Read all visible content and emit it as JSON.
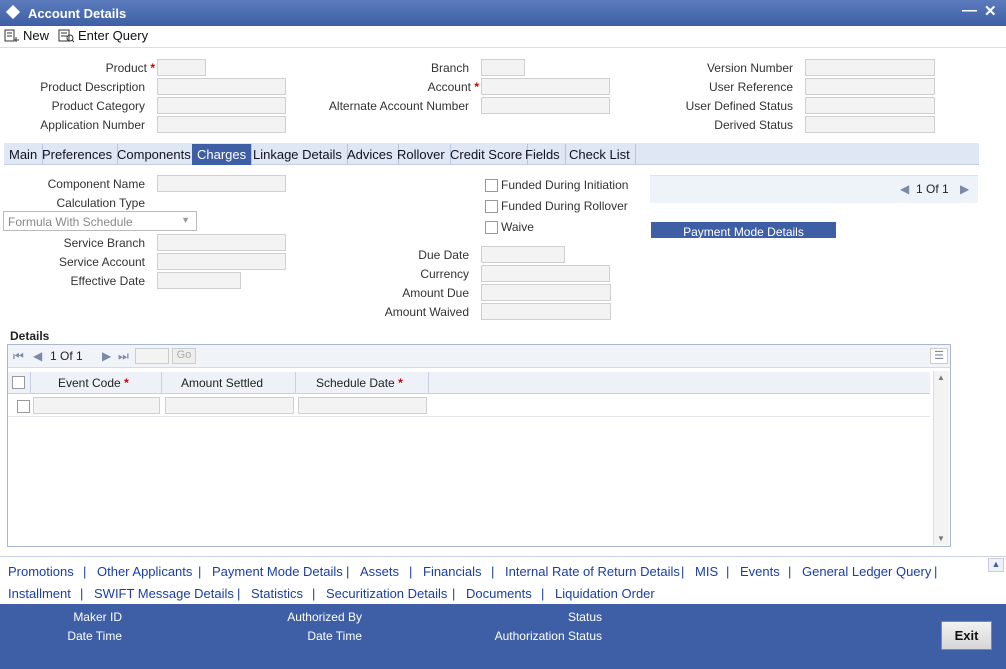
{
  "window": {
    "title": "Account Details",
    "minimize_icon": "minimize-icon",
    "close_icon": "close-icon"
  },
  "toolbar": {
    "new_label": "New",
    "enter_query_label": "Enter Query"
  },
  "header": {
    "product_label": "Product",
    "product_description_label": "Product Description",
    "product_category_label": "Product Category",
    "application_number_label": "Application Number",
    "branch_label": "Branch",
    "account_label": "Account",
    "alternate_account_number_label": "Alternate Account Number",
    "version_number_label": "Version Number",
    "user_reference_label": "User Reference",
    "user_defined_status_label": "User Defined Status",
    "derived_status_label": "Derived Status",
    "required_mark": "*"
  },
  "tabs": [
    "Main",
    "Preferences",
    "Components",
    "Charges",
    "Linkage Details",
    "Advices",
    "Rollover",
    "Credit Score",
    "Fields",
    "Check List"
  ],
  "charges": {
    "component_name_label": "Component Name",
    "calculation_type_label": "Calculation Type",
    "calculation_type_value": "Formula With Schedule",
    "service_branch_label": "Service Branch",
    "service_account_label": "Service Account",
    "effective_date_label": "Effective Date",
    "funded_during_initiation_label": "Funded During Initiation",
    "funded_during_rollover_label": "Funded During Rollover",
    "waive_label": "Waive",
    "due_date_label": "Due Date",
    "currency_label": "Currency",
    "amount_due_label": "Amount Due",
    "amount_waived_label": "Amount Waived",
    "pager_text": "1 Of 1",
    "payment_mode_button": "Payment Mode Details"
  },
  "details": {
    "section_title": "Details",
    "pager_text": "1 Of 1",
    "go_label": "Go",
    "columns": [
      "Event Code",
      "Amount Settled",
      "Schedule Date"
    ]
  },
  "links_row1": [
    "Promotions",
    "Other Applicants",
    "Payment Mode Details",
    "Assets",
    "Financials",
    "Internal Rate of Return Details",
    "MIS",
    "Events",
    "General Ledger Query"
  ],
  "links_row2": [
    "Installment",
    "SWIFT Message Details",
    "Statistics",
    "Securitization Details",
    "Documents",
    "Liquidation Order"
  ],
  "link_separator": "|",
  "footer": {
    "maker_id_label": "Maker ID",
    "date_time_label_1": "Date Time",
    "authorized_by_label": "Authorized By",
    "date_time_label_2": "Date Time",
    "status_label": "Status",
    "authorization_status_label": "Authorization Status",
    "exit_label": "Exit"
  },
  "colors": {
    "accent": "#3e5fa5",
    "link": "#1a3ea8",
    "required": "#cc0000"
  }
}
